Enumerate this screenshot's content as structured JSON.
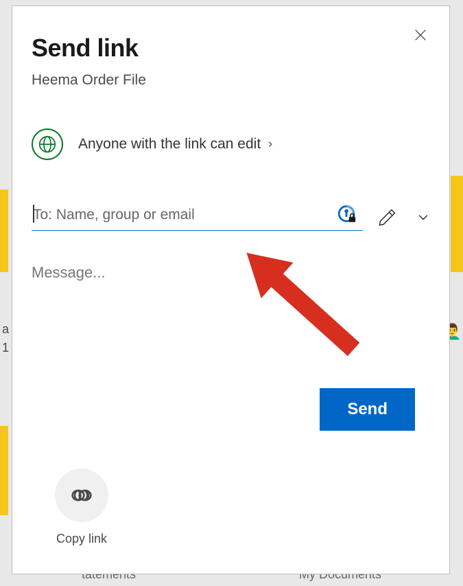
{
  "dialog": {
    "title": "Send link",
    "subtitle": "Heema Order File",
    "permission_text": "Anyone with the link can edit",
    "to_placeholder": "To: Name, group or email",
    "message_placeholder": "Message...",
    "send_label": "Send",
    "copy_link_label": "Copy link"
  },
  "bg": {
    "bottom_left": "tatements",
    "bottom_right": "My Documents",
    "left_a": "a",
    "left_1": "1"
  }
}
